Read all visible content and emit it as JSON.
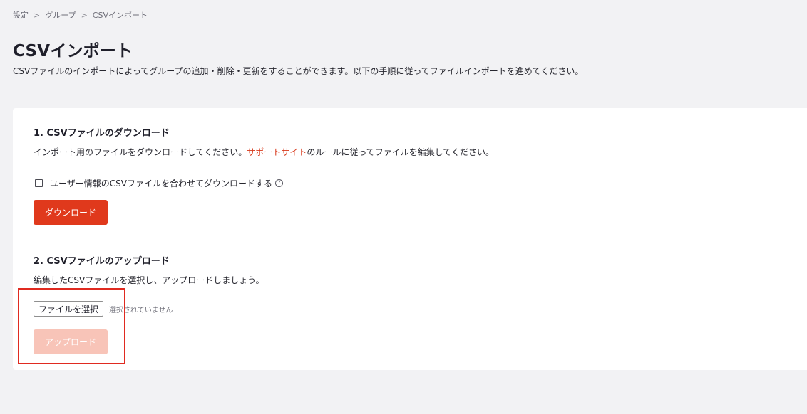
{
  "breadcrumb": {
    "items": [
      "設定",
      "グループ",
      "CSVインポート"
    ],
    "separator": ">"
  },
  "header": {
    "title": "CSVインポート",
    "description": "CSVファイルのインポートによってグループの追加・削除・更新をすることができます。以下の手順に従ってファイルインポートを進めてください。"
  },
  "download_section": {
    "title": "1. CSVファイルのダウンロード",
    "desc_before": "インポート用のファイルをダウンロードしてください。",
    "support_link": "サポートサイト",
    "desc_after": "のルールに従ってファイルを編集してください。",
    "checkbox_label": "ユーザー情報のCSVファイルを合わせてダウンロードする",
    "checkbox_checked": false,
    "help_icon": "?",
    "button_label": "ダウンロード"
  },
  "upload_section": {
    "title": "2. CSVファイルのアップロード",
    "description": "編集したCSVファイルを選択し、アップロードしましょう。",
    "file_button_label": "ファイルを選択",
    "file_status": "選択されていません",
    "button_label": "アップロード",
    "button_enabled": false
  },
  "colors": {
    "accent": "#e0391c",
    "accent_disabled": "#f8c4b8",
    "link": "#d8391b",
    "highlight": "#e02a20",
    "background": "#f2f2f4"
  }
}
